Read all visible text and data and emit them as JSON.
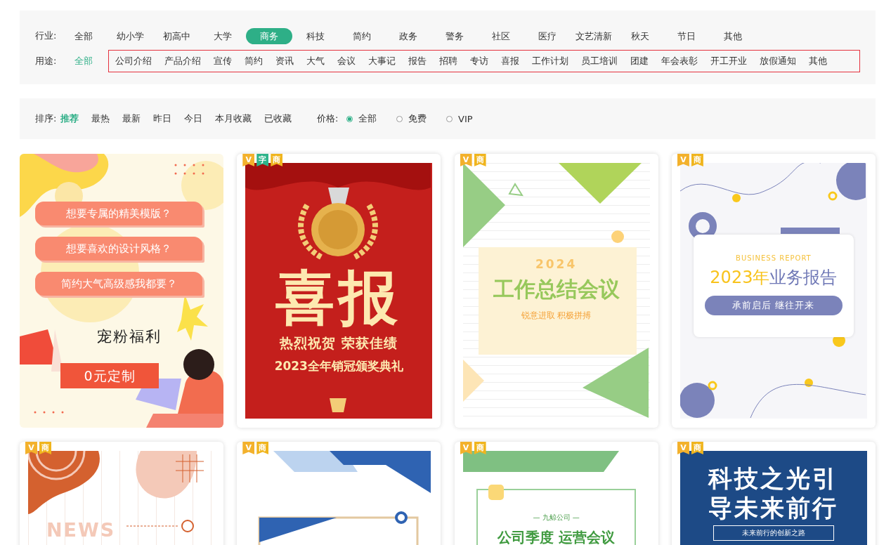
{
  "industry": {
    "label": "行业:",
    "items": [
      {
        "label": "全部",
        "selected": false
      },
      {
        "label": "幼小学",
        "selected": false
      },
      {
        "label": "初高中",
        "selected": false
      },
      {
        "label": "大学",
        "selected": false
      },
      {
        "label": "商务",
        "selected": true
      },
      {
        "label": "科技",
        "selected": false
      },
      {
        "label": "简约",
        "selected": false
      },
      {
        "label": "政务",
        "selected": false
      },
      {
        "label": "警务",
        "selected": false
      },
      {
        "label": "社区",
        "selected": false
      },
      {
        "label": "医疗",
        "selected": false
      },
      {
        "label": "文艺清新",
        "selected": false
      },
      {
        "label": "秋天",
        "selected": false
      },
      {
        "label": "节日",
        "selected": false
      },
      {
        "label": "其他",
        "selected": false
      }
    ]
  },
  "usage": {
    "label": "用途:",
    "highlight_box": true,
    "items": [
      {
        "label": "全部",
        "selected": true
      },
      {
        "label": "公司介绍",
        "selected": false
      },
      {
        "label": "产品介绍",
        "selected": false
      },
      {
        "label": "宣传",
        "selected": false
      },
      {
        "label": "简约",
        "selected": false
      },
      {
        "label": "资讯",
        "selected": false
      },
      {
        "label": "大气",
        "selected": false
      },
      {
        "label": "会议",
        "selected": false
      },
      {
        "label": "大事记",
        "selected": false
      },
      {
        "label": "报告",
        "selected": false
      },
      {
        "label": "招聘",
        "selected": false
      },
      {
        "label": "专访",
        "selected": false
      },
      {
        "label": "喜报",
        "selected": false
      },
      {
        "label": "工作计划",
        "selected": false
      },
      {
        "label": "员工培训",
        "selected": false
      },
      {
        "label": "团建",
        "selected": false
      },
      {
        "label": "年会表彰",
        "selected": false
      },
      {
        "label": "开工开业",
        "selected": false
      },
      {
        "label": "放假通知",
        "selected": false
      },
      {
        "label": "其他",
        "selected": false
      }
    ]
  },
  "sort": {
    "label": "排序:",
    "items": [
      {
        "label": "推荐",
        "selected": true
      },
      {
        "label": "最热",
        "selected": false
      },
      {
        "label": "最新",
        "selected": false
      },
      {
        "label": "昨日",
        "selected": false
      },
      {
        "label": "今日",
        "selected": false
      },
      {
        "label": "本月收藏",
        "selected": false
      },
      {
        "label": "已收藏",
        "selected": false
      }
    ]
  },
  "price": {
    "label": "价格:",
    "options": [
      {
        "label": "全部",
        "selected": true
      },
      {
        "label": "免费",
        "selected": false
      },
      {
        "label": "VIP",
        "selected": false
      }
    ]
  },
  "templates": [
    {
      "kind": "promo",
      "texts": [
        "想要专属的精美模版？",
        "想要喜欢的设计风格？",
        "简约大气高级感我都要？",
        "宠粉福利",
        "0元定制"
      ]
    },
    {
      "kind": "award",
      "badges": [
        {
          "kind": "vip",
          "text": "V"
        },
        {
          "kind": "font",
          "text": "字"
        },
        {
          "kind": "commercial",
          "text": "商"
        }
      ],
      "texts": [
        "喜报",
        "热烈祝贺 荣获佳绩",
        "2023全年销冠颁奖典礼"
      ]
    },
    {
      "kind": "meeting",
      "badges": [
        {
          "kind": "vip",
          "text": "V"
        },
        {
          "kind": "commercial",
          "text": "商"
        }
      ],
      "texts": [
        "2024",
        "工作总结会议",
        "锐意进取 积极拼搏"
      ]
    },
    {
      "kind": "report",
      "badges": [
        {
          "kind": "vip",
          "text": "V"
        },
        {
          "kind": "commercial",
          "text": "商"
        }
      ],
      "texts": [
        "BUSINESS REPORT",
        "2023年",
        "业务报告",
        "承前启后 继往开来"
      ]
    },
    {
      "kind": "news",
      "badges": [
        {
          "kind": "vip",
          "text": "V"
        },
        {
          "kind": "commercial",
          "text": "商"
        }
      ],
      "texts": [
        "NEWS"
      ]
    },
    {
      "kind": "frame",
      "badges": [
        {
          "kind": "vip",
          "text": "V"
        },
        {
          "kind": "commercial",
          "text": "商"
        }
      ]
    },
    {
      "kind": "green",
      "badges": [
        {
          "kind": "vip",
          "text": "V"
        },
        {
          "kind": "commercial",
          "text": "商"
        }
      ],
      "texts": [
        "— 九鲸公司 —",
        "公司季度 运营会议"
      ]
    },
    {
      "kind": "tech",
      "badges": [
        {
          "kind": "vip",
          "text": "V"
        },
        {
          "kind": "commercial",
          "text": "商"
        }
      ],
      "texts": [
        "科技之光引",
        "导未来前行",
        "未来前行的创新之路"
      ]
    }
  ]
}
